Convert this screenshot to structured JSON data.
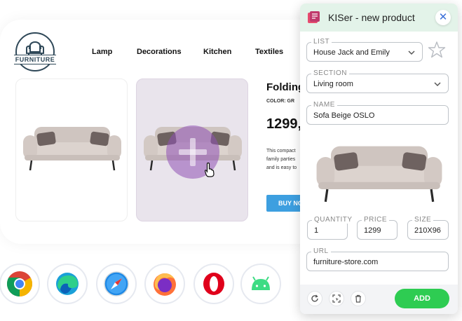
{
  "site": {
    "logo_text": "FURNITURE",
    "nav": [
      "Lamp",
      "Decorations",
      "Kitchen",
      "Textiles"
    ],
    "product": {
      "title": "Folding",
      "color_label": "COLOR: GR",
      "price": "1299,",
      "description": [
        "This compact",
        "family parties",
        "and is easy to"
      ],
      "buy_label": "BUY NO"
    },
    "sofa_color": "#d8cfca",
    "browsers": [
      {
        "name": "Chrome",
        "icon": "chrome-icon"
      },
      {
        "name": "Edge",
        "icon": "edge-icon"
      },
      {
        "name": "Safari",
        "icon": "safari-icon"
      },
      {
        "name": "Firefox",
        "icon": "firefox-icon"
      },
      {
        "name": "Opera",
        "icon": "opera-icon"
      },
      {
        "name": "Android",
        "icon": "android-icon"
      }
    ]
  },
  "popup": {
    "title": "KISer - new product",
    "close_glyph": "✕",
    "list": {
      "label": "LIST",
      "value": "House Jack and Emily"
    },
    "section": {
      "label": "SECTION",
      "value": "Living room"
    },
    "name": {
      "label": "NAME",
      "value": "Sofa Beige OSLO"
    },
    "quantity": {
      "label": "QUANTITY",
      "value": "1"
    },
    "price": {
      "label": "PRICE",
      "value": "1299"
    },
    "size": {
      "label": "SIZE",
      "value": "210X96"
    },
    "url": {
      "label": "URL",
      "value": "furniture-store.com"
    },
    "add_label": "ADD",
    "accent_green": "#2ecc52",
    "header_bg": "#e3f3e9"
  }
}
